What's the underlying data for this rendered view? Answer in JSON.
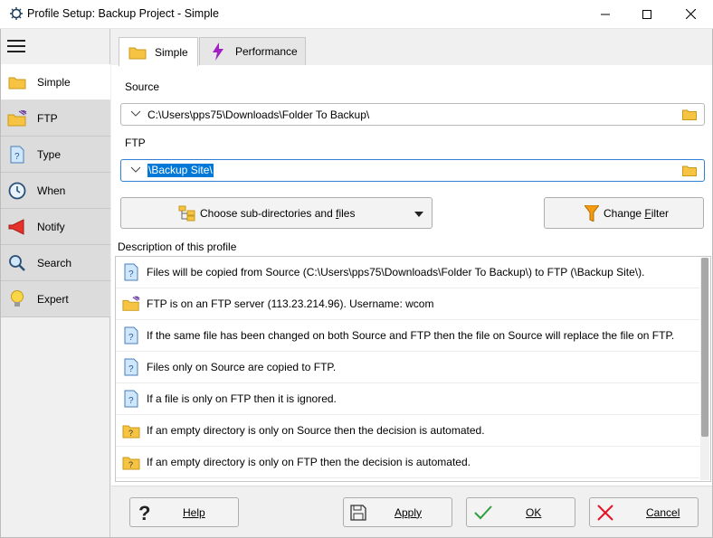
{
  "window": {
    "title": "Profile Setup: Backup Project - Simple"
  },
  "sidebar": {
    "items": [
      {
        "label": "Simple",
        "icon": "folder-icon"
      },
      {
        "label": "FTP",
        "icon": "ftp-folder-icon"
      },
      {
        "label": "Type",
        "icon": "help-document-icon"
      },
      {
        "label": "When",
        "icon": "clock-icon"
      },
      {
        "label": "Notify",
        "icon": "megaphone-icon"
      },
      {
        "label": "Search",
        "icon": "magnifier-icon"
      },
      {
        "label": "Expert",
        "icon": "lightbulb-icon"
      }
    ]
  },
  "tabs": [
    {
      "label": "Simple",
      "icon": "folder-icon"
    },
    {
      "label": "Performance",
      "icon": "lightning-icon"
    }
  ],
  "source": {
    "label": "Source",
    "value": "C:\\Users\\pps75\\Downloads\\Folder To Backup\\"
  },
  "ftp": {
    "label": "FTP",
    "value": "\\Backup Site\\"
  },
  "buttons": {
    "choose_subdirs_pre": "Choose sub-directories and ",
    "choose_subdirs_key": "f",
    "choose_subdirs_post": "iles",
    "change_filter_pre": "Change ",
    "change_filter_key": "F",
    "change_filter_post": "ilter",
    "help": "Help",
    "apply": "Apply",
    "ok": "OK",
    "cancel": "Cancel"
  },
  "description": {
    "label": "Description of this profile",
    "rows": [
      {
        "text": "Files will be copied from Source (C:\\Users\\pps75\\Downloads\\Folder To Backup\\) to FTP (\\Backup Site\\).",
        "icon": "info-document-icon"
      },
      {
        "text": "FTP is on an FTP server (113.23.214.96). Username: wcom",
        "icon": "ftp-folder-icon"
      },
      {
        "text": "If the same file has been changed on both Source and FTP then the file on Source will replace the file on FTP.",
        "icon": "info-document-icon"
      },
      {
        "text": "Files only on Source are copied to FTP.",
        "icon": "info-document-icon"
      },
      {
        "text": "If a file is only on FTP then it is ignored.",
        "icon": "info-document-icon"
      },
      {
        "text": "If an empty directory is only on Source then the decision is automated.",
        "icon": "question-folder-icon"
      },
      {
        "text": "If an empty directory is only on FTP then the decision is automated.",
        "icon": "question-folder-icon"
      }
    ]
  },
  "colors": {
    "accent": "#0078d7",
    "folder": "#f6c342",
    "cancel_red": "#e81123",
    "ok_green": "#2e9e3e"
  }
}
